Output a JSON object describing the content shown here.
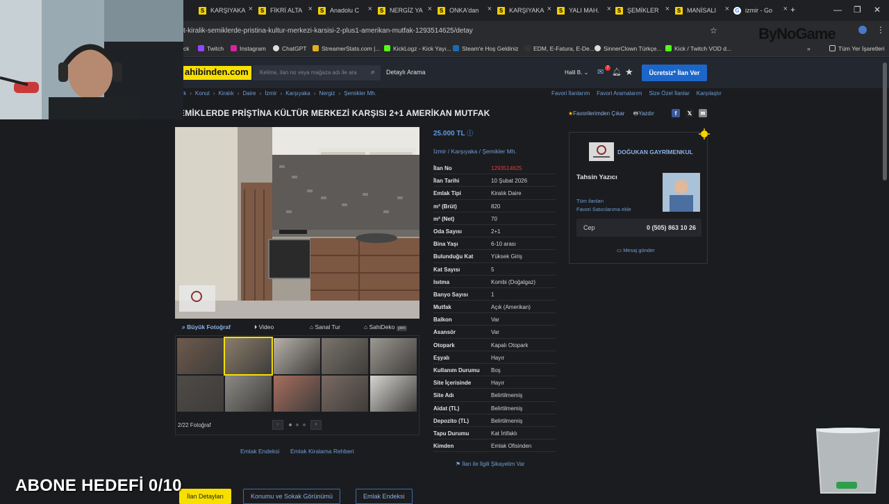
{
  "browser": {
    "tabs": [
      {
        "label": "KARŞIYAKA",
        "fav": "S"
      },
      {
        "label": "FİKRİ ALTA",
        "fav": "S"
      },
      {
        "label": "Anadolu C",
        "fav": "S"
      },
      {
        "label": "NERGİZ YA",
        "fav": "S"
      },
      {
        "label": "ONKA'dan",
        "fav": "S"
      },
      {
        "label": "KARŞIYAKA",
        "fav": "S"
      },
      {
        "label": "YALI MAH.",
        "fav": "S"
      },
      {
        "label": "ŞEMİKLER",
        "fav": "S"
      },
      {
        "label": "MANİSALI",
        "fav": "S"
      },
      {
        "label": "izmir - Go",
        "fav": "G"
      }
    ],
    "url": "t-kiralik-semiklerde-pristina-kultur-merkezi-karsisi-2-plus1-amerikan-mutfak-1293514625/detay",
    "bookmarks": [
      "ck",
      "Twitch",
      "Instagram",
      "ChatGPT",
      "StreamerStats.com |...",
      "KickLogz - Kick Yayı...",
      "Steam'e Hoş Geldiniz",
      "EDM, E-Fatura, E-De...",
      "SinnerClown Türkçe...",
      "Kick / Twitch VOD d..."
    ],
    "all_bookmarks": "Tüm Yer İşaretleri"
  },
  "site": {
    "logo": "ahibinden.com",
    "search_placeholder": "Kelime, ilan no veya mağaza adı ile ara",
    "detailed_search": "Detaylı Arama",
    "user": "Halil B.",
    "msg_count": "7",
    "post_button": "Ücretsiz* İlan Ver"
  },
  "breadcrumbs": [
    "lak",
    "Konut",
    "Kiralık",
    "Daire",
    "İzmir",
    "Karşıyaka",
    "Nergiz",
    "Şemikler Mh."
  ],
  "right_links": [
    "Favori İlanlarım",
    "Favori Aramalarım",
    "Size Özel İlanlar",
    "Karşılaştır"
  ],
  "title": "EMİKLERDE PRİŞTİNA KÜLTÜR MERKEZİ KARŞISI 2+1 AMERİKAN MUTFAK",
  "title_actions": {
    "unfav": "Favorilerimden Çıkar",
    "print": "Yazdır"
  },
  "gallery": {
    "tabs": [
      "Büyük Fotoğraf",
      "Video",
      "Sanal Tur",
      "SahiDeko",
      "yeni"
    ],
    "count": "2/22 Fotoğraf",
    "watermark": "DOĞUKAN GAYRİMENKUL"
  },
  "price": "25.000 TL",
  "location": "İzmir  /  Karşıyaka  /  Şemikler Mh.",
  "details": [
    {
      "k": "İlan No",
      "v": "1293514625"
    },
    {
      "k": "İlan Tarihi",
      "v": "10 Şubat 2026"
    },
    {
      "k": "Emlak Tipi",
      "v": "Kiralık Daire"
    },
    {
      "k": "m² (Brüt)",
      "v": "820"
    },
    {
      "k": "m² (Net)",
      "v": "70"
    },
    {
      "k": "Oda Sayısı",
      "v": "2+1"
    },
    {
      "k": "Bina Yaşı",
      "v": "6-10 arası"
    },
    {
      "k": "Bulunduğu Kat",
      "v": "Yüksek Giriş"
    },
    {
      "k": "Kat Sayısı",
      "v": "5"
    },
    {
      "k": "Isıtma",
      "v": "Kombi (Doğalgaz)"
    },
    {
      "k": "Banyo Sayısı",
      "v": "1"
    },
    {
      "k": "Mutfak",
      "v": "Açık (Amerikan)"
    },
    {
      "k": "Balkon",
      "v": "Var"
    },
    {
      "k": "Asansör",
      "v": "Var"
    },
    {
      "k": "Otopark",
      "v": "Kapalı Otopark"
    },
    {
      "k": "Eşyalı",
      "v": "Hayır"
    },
    {
      "k": "Kullanım Durumu",
      "v": "Boş"
    },
    {
      "k": "Site İçerisinde",
      "v": "Hayır"
    },
    {
      "k": "Site Adı",
      "v": "Belirtilmemiş"
    },
    {
      "k": "Aidat (TL)",
      "v": "Belirtilmemiş"
    },
    {
      "k": "Depozito (TL)",
      "v": "Belirtilmemiş"
    },
    {
      "k": "Tapu Durumu",
      "v": "Kat İrtifaklı"
    },
    {
      "k": "Kimden",
      "v": "Emlak Ofisinden"
    }
  ],
  "complaint": "İlan ile İlgili Şikayetim Var",
  "bottom_links": [
    "Emlak Endeksi",
    "Emlak Kiralama Rehberi"
  ],
  "seller": {
    "name": "DOĞUKAN GAYRİMENKUL",
    "agent": "Tahsin Yazıcı",
    "all_listings": "Tüm ilanları",
    "fav_seller": "Favori Satıcılarıma ekle",
    "phone_label": "Cep",
    "phone": "0 (505) 863 10 26",
    "message": "Mesaj gönder"
  },
  "bottom_tabs": [
    "İlan Detayları",
    "Konumu ve Sokak Görünümü",
    "Emlak Endeksi"
  ],
  "overlay": {
    "goal": "ABONE HEDEFİ 0/10",
    "brand": "ByNoGame"
  },
  "colors": {
    "accent": "#1d66c9",
    "link": "#6f9fd8",
    "logo": "#f7e000",
    "price": "#5b9bea",
    "listing_no": "#e03b3b"
  }
}
